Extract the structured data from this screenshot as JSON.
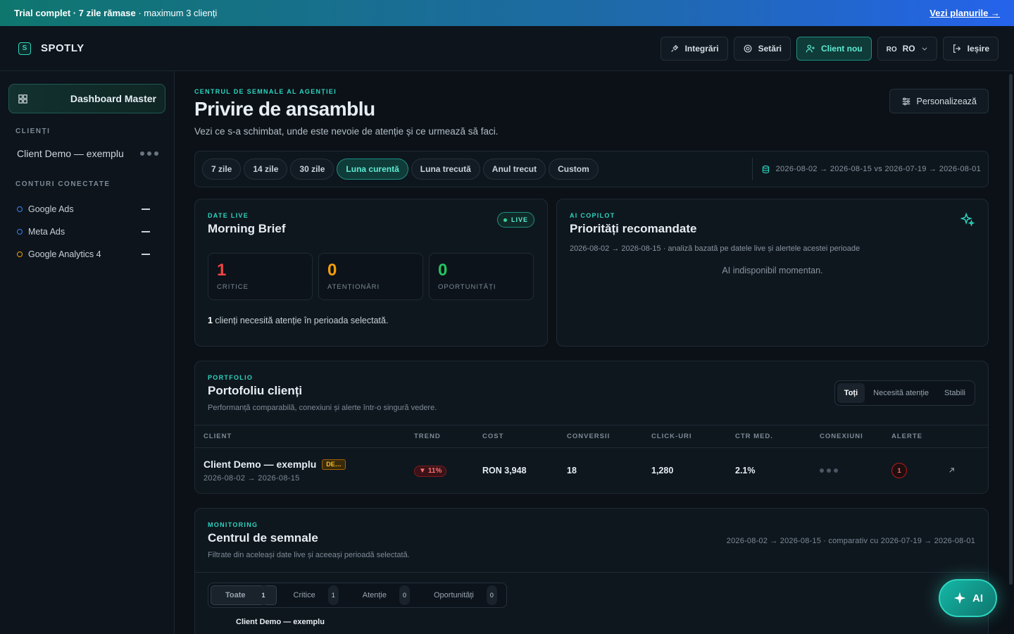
{
  "banner": {
    "message_bold": "Trial complet · 7 zile rămase",
    "message_rest": " · maximum 3 clienți",
    "link": "Vezi planurile →"
  },
  "brand": {
    "logo_letter": "S",
    "name": "SPOTLY"
  },
  "topnav": {
    "integrations": "Integrări",
    "settings": "Setări",
    "new_client": "Client nou",
    "lang_small": "RO",
    "lang": "RO",
    "logout": "Ieșire"
  },
  "sidebar": {
    "dashboard": "Dashboard Master",
    "clients_heading": "CLIENȚI",
    "client": "Client Demo — exemplu",
    "accounts_heading": "CONTURI CONECTATE",
    "accounts": [
      {
        "label": "Google Ads",
        "color": "#3b82f6"
      },
      {
        "label": "Meta Ads",
        "color": "#3b82f6"
      },
      {
        "label": "Google Analytics 4",
        "color": "#f59e0b"
      }
    ]
  },
  "header": {
    "kicker": "CENTRUL DE SEMNALE AL AGENȚIEI",
    "title": "Privire de ansamblu",
    "subtitle": "Vezi ce s-a schimbat, unde este nevoie de atenție și ce urmează să faci.",
    "customize": "Personalizează"
  },
  "filters": {
    "ranges": [
      "7 zile",
      "14 zile",
      "30 zile",
      "Luna curentă",
      "Luna trecută",
      "Anul trecut",
      "Custom"
    ],
    "active_index": 3,
    "date_range": "2026-08-02 → 2026-08-15 vs 2026-07-19 → 2026-08-01"
  },
  "brief": {
    "kicker": "DATE LIVE",
    "title": "Morning Brief",
    "live": "LIVE",
    "stats": [
      {
        "value": "1",
        "label": "CRITICE",
        "color": "#ef4444"
      },
      {
        "value": "0",
        "label": "ATENȚIONĂRI",
        "color": "#f59e0b"
      },
      {
        "value": "0",
        "label": "OPORTUNITĂȚI",
        "color": "#22c55e"
      }
    ],
    "note_count": "1",
    "note_text": " clienți necesită atenție în perioada selectată."
  },
  "copilot": {
    "kicker": "AI COPILOT",
    "title": "Priorități recomandate",
    "range": "2026-08-02 → 2026-08-15 · analiză bazată pe datele live și alertele acestei perioade",
    "empty": "AI indisponibil momentan."
  },
  "portfolio": {
    "kicker": "PORTFOLIO",
    "title": "Portofoliu clienți",
    "subtitle": "Performanță comparabilă, conexiuni și alerte într-o singură vedere.",
    "segments": [
      "Toți",
      "Necesită atenție",
      "Stabili"
    ],
    "columns": [
      "CLIENT",
      "TREND",
      "COST",
      "CONVERSII",
      "CLICK-URI",
      "CTR MED.",
      "CONEXIUNI",
      "ALERTE"
    ],
    "row": {
      "client": "Client Demo — exemplu",
      "badge": "DE…",
      "dates": "2026-08-02 → 2026-08-15",
      "trend": "11%",
      "cost": "RON 3,948",
      "conversions": "18",
      "clicks": "1,280",
      "ctr": "2.1%",
      "alerts": "1"
    }
  },
  "signals": {
    "kicker": "MONITORING",
    "title": "Centrul de semnale",
    "subtitle": "Filtrate din aceleași date live și aceeași perioadă selectată.",
    "range": "2026-08-02 → 2026-08-15 · comparativ cu 2026-07-19 → 2026-08-01",
    "tabs": [
      {
        "label": "Toate",
        "count": "1"
      },
      {
        "label": "Critice",
        "count": "1"
      },
      {
        "label": "Atenție",
        "count": "0"
      },
      {
        "label": "Oportunități",
        "count": "0"
      }
    ],
    "first_row": "Client Demo — exemplu"
  },
  "fab": {
    "label": "AI"
  },
  "icons": {
    "integrations": "plug-icon",
    "settings": "gear-icon",
    "new_client": "user-plus-icon",
    "logout": "logout-icon",
    "dashboard": "grid-icon",
    "customize": "sliders-icon",
    "calendar": "database-icon",
    "copilot": "sparkle-icon",
    "open": "arrow-up-right-icon"
  }
}
